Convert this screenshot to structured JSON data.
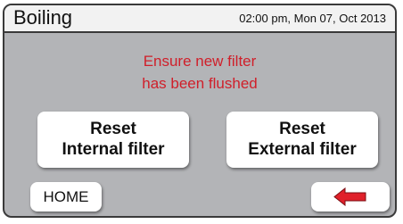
{
  "header": {
    "title": "Boiling",
    "datetime": "02:00 pm, Mon 07, Oct 2013"
  },
  "message": {
    "line1": "Ensure new filter",
    "line2": "has been flushed",
    "color": "#d01f2a"
  },
  "buttons": {
    "reset_internal": {
      "line1": "Reset",
      "line2": "Internal filter"
    },
    "reset_external": {
      "line1": "Reset",
      "line2": "External filter"
    },
    "home": "HOME",
    "back": {
      "icon": "back-arrow-icon",
      "color": "#e0202a"
    }
  },
  "colors": {
    "screen_bg": "#b3b4b7",
    "header_bg": "#f2f2f2",
    "border": "#3a3a3a"
  }
}
